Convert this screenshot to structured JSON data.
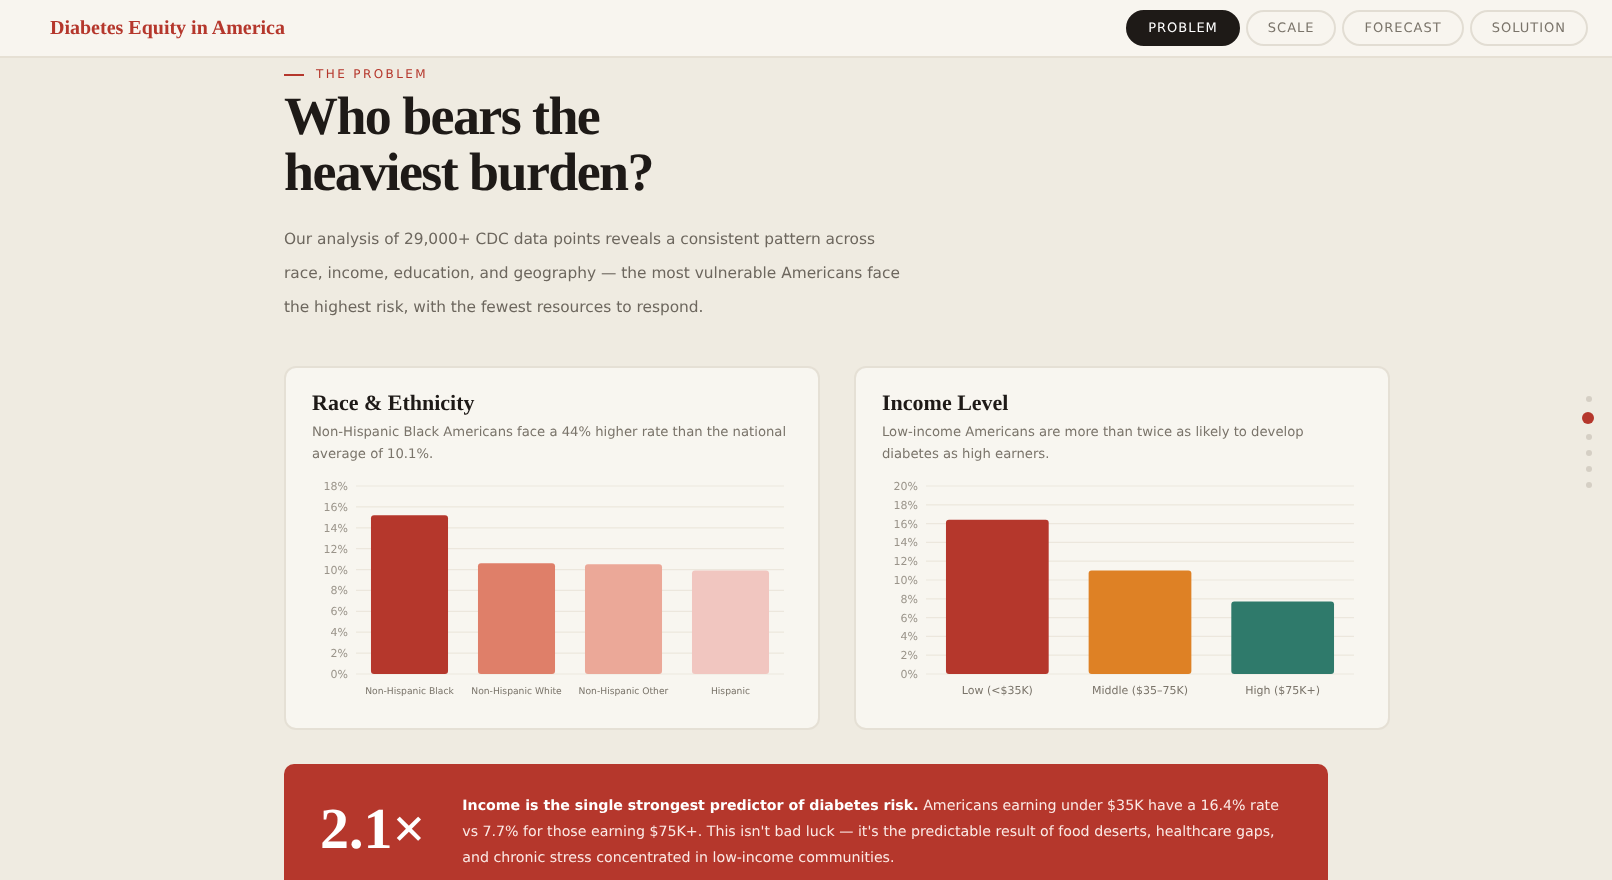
{
  "header": {
    "brand": "Diabetes Equity in America",
    "nav": [
      {
        "label": "PROBLEM",
        "selected": true
      },
      {
        "label": "SCALE",
        "selected": false
      },
      {
        "label": "FORECAST",
        "selected": false
      },
      {
        "label": "SOLUTION",
        "selected": false
      }
    ]
  },
  "section": {
    "eyebrow": "THE PROBLEM",
    "title_lines": [
      "Who bears the",
      "heaviest burden?"
    ],
    "intro": "Our analysis of 29,000+ CDC data points reveals a consistent pattern across race, income, education, and geography — the most vulnerable Americans face the highest risk, with the fewest resources to respond."
  },
  "cards": [
    {
      "title": "Race & Ethnicity",
      "subtitle": "Non-Hispanic Black Americans face a 44% higher rate than the national average of 10.1%.",
      "chart_data": {
        "type": "bar",
        "categories": [
          "Non-Hispanic Black",
          "Non-Hispanic White",
          "Non-Hispanic Other",
          "Hispanic"
        ],
        "colors": [
          "#b5372c",
          "#df7f69",
          "#eba898",
          "#f1c6c0"
        ],
        "values": [
          15.2,
          10.6,
          10.5,
          9.9
        ],
        "grid": true,
        "ylim": [
          0,
          18
        ],
        "yticks": [
          {
            "value": 0,
            "label": "0%"
          },
          {
            "value": 2,
            "label": "2%"
          },
          {
            "value": 4,
            "label": "4%"
          },
          {
            "value": 6,
            "label": "6%"
          },
          {
            "value": 8,
            "label": "8%"
          },
          {
            "value": 10,
            "label": "10%"
          },
          {
            "value": 12,
            "label": "12%"
          },
          {
            "value": 14,
            "label": "14%"
          },
          {
            "value": 16,
            "label": "16%"
          },
          {
            "value": 18,
            "label": "18%"
          }
        ]
      }
    },
    {
      "title": "Income Level",
      "subtitle": "Low-income Americans are more than twice as likely to develop diabetes as high earners.",
      "chart_data": {
        "type": "bar",
        "categories": [
          "Low (<$35K)",
          "Middle ($35–75K)",
          "High ($75K+)"
        ],
        "colors": [
          "#b5372c",
          "#de8125",
          "#2f7a6b"
        ],
        "values": [
          16.4,
          11.0,
          7.7
        ],
        "grid": true,
        "ylim": [
          0,
          20
        ],
        "yticks": [
          {
            "value": 0,
            "label": "0%"
          },
          {
            "value": 2,
            "label": "2%"
          },
          {
            "value": 4,
            "label": "4%"
          },
          {
            "value": 6,
            "label": "6%"
          },
          {
            "value": 8,
            "label": "8%"
          },
          {
            "value": 10,
            "label": "10%"
          },
          {
            "value": 12,
            "label": "12%"
          },
          {
            "value": 14,
            "label": "14%"
          },
          {
            "value": 16,
            "label": "16%"
          },
          {
            "value": 18,
            "label": "18%"
          },
          {
            "value": 20,
            "label": "20%"
          }
        ]
      }
    }
  ],
  "callout": {
    "stat": "2.1×",
    "text": "**Income is the single strongest predictor of diabetes risk.** Americans earning under $35K have a 16.4% rate vs 7.7% for those earning $75K+. This isn't bad luck — it's the predictable result of food deserts, healthcare gaps, and chronic stress concentrated in low-income communities."
  },
  "side_dots": [
    {
      "selected": false
    },
    {
      "selected": true
    },
    {
      "selected": false
    },
    {
      "selected": false
    },
    {
      "selected": false
    },
    {
      "selected": false
    }
  ]
}
